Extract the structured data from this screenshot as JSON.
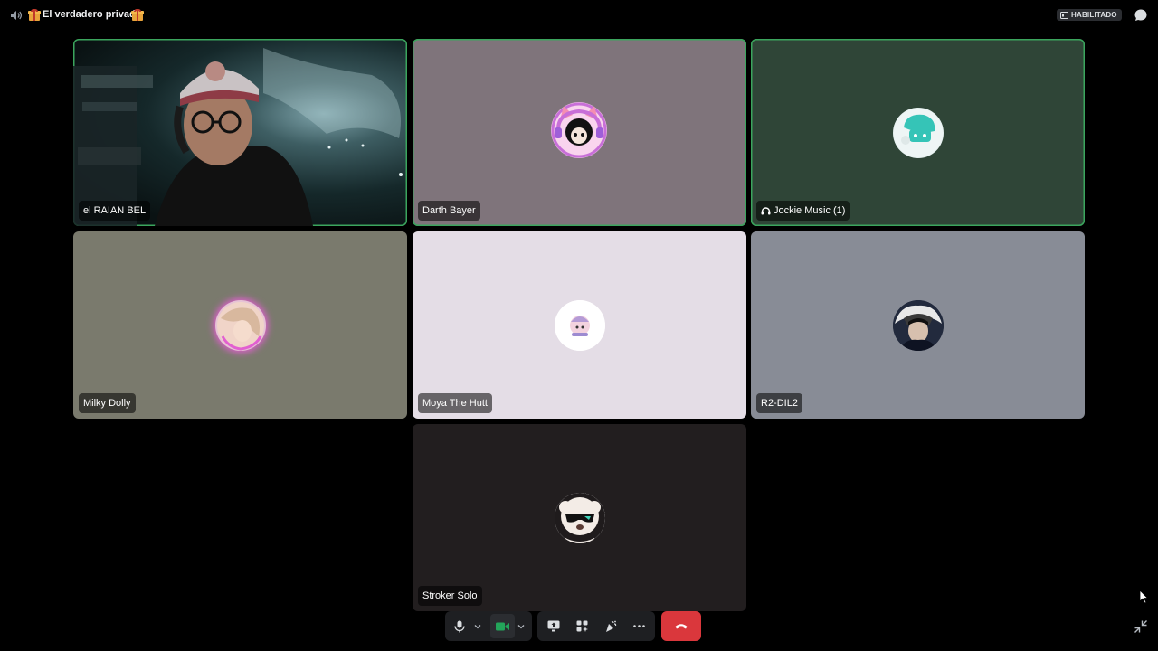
{
  "header": {
    "channel_name": "El verdadero privado",
    "channel_icon": "speaker-channel-icon",
    "decoration_icon": "gift-emoji",
    "badge_label": "HABILITADO",
    "badge_icon": "activity-icon",
    "chat_icon": "chat-bubble-icon"
  },
  "participants": [
    {
      "name": "el RAIAN BEL",
      "video": "webcam",
      "speaking": true
    },
    {
      "name": "Darth Bayer",
      "avatar": "cat-ears-headset-avatar",
      "speaking": true
    },
    {
      "name": "Jockie Music (1)",
      "avatar": "jockie-robot-avatar",
      "speaking": true,
      "bot": true
    },
    {
      "name": "Milky Dolly",
      "avatar": "pink-glow-avatar",
      "speaking": false
    },
    {
      "name": "Moya The Hutt",
      "avatar": "cute-character-avatar",
      "speaking": false
    },
    {
      "name": "R2-DIL2",
      "avatar": "hooded-raccoon-avatar",
      "speaking": false
    },
    {
      "name": "Stroker Solo",
      "avatar": "sunglasses-dog-avatar",
      "speaking": false
    }
  ],
  "controls": {
    "microphone": "microphone-icon",
    "microphone_options": "chevron-down-icon",
    "camera": "camera-icon",
    "camera_on": true,
    "camera_options": "chevron-down-icon",
    "screen_share": "screen-share-icon",
    "activities": "activities-icon",
    "soundboard": "soundboard-icon",
    "more": "more-options-icon",
    "disconnect": "hang-up-icon",
    "fullscreen": "exit-fullscreen-icon"
  },
  "colors": {
    "speaking_ring": "#3ba55d",
    "hangup": "#da373c",
    "camera_active": "#23a55a"
  }
}
